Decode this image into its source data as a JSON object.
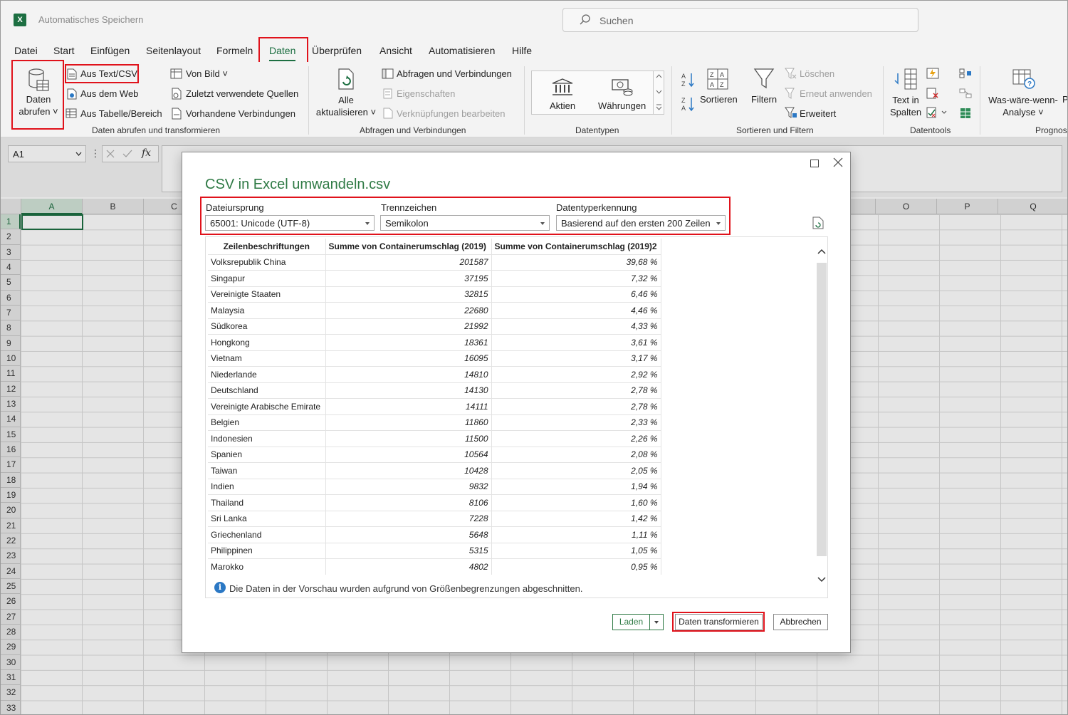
{
  "app": {
    "autosave_label": "Automatisches Speichern",
    "search_placeholder": "Suchen",
    "logo_letter": "X"
  },
  "menu_tabs": [
    "Datei",
    "Start",
    "Einfügen",
    "Seitenlayout",
    "Formeln",
    "Daten",
    "Überprüfen",
    "Ansicht",
    "Automatisieren",
    "Hilfe"
  ],
  "ribbon": {
    "get_data": {
      "label_line1": "Daten",
      "label_line2": "abrufen"
    },
    "from_text_csv": "Aus Text/CSV",
    "from_web": "Aus dem Web",
    "from_table": "Aus Tabelle/Bereich",
    "from_picture": "Von Bild",
    "recent_sources": "Zuletzt verwendete Quellen",
    "existing_connections": "Vorhandene Verbindungen",
    "group_get_transform": "Daten abrufen und transformieren",
    "refresh_all": {
      "label_line1": "Alle",
      "label_line2": "aktualisieren"
    },
    "queries_connections": "Abfragen und Verbindungen",
    "properties": "Eigenschaften",
    "edit_links": "Verknüpfungen bearbeiten",
    "group_queries": "Abfragen und Verbindungen",
    "stocks": "Aktien",
    "currencies": "Währungen",
    "group_datatypes": "Datentypen",
    "sort": "Sortieren",
    "filter": "Filtern",
    "clear": "Löschen",
    "reapply": "Erneut anwenden",
    "advanced": "Erweitert",
    "group_sort_filter": "Sortieren und Filtern",
    "text_to_columns": {
      "label_line1": "Text in",
      "label_line2": "Spalten"
    },
    "group_datatools": "Datentools",
    "whatif": {
      "label_line1": "Was-wäre-wenn-",
      "label_line2": "Analyse"
    },
    "forecast_trunc": "Prognos",
    "p_trunc": "P"
  },
  "formula_bar": {
    "name_box": "A1",
    "fx": "fx"
  },
  "grid": {
    "columns_left": [
      "A",
      "B",
      "C"
    ],
    "columns_right": [
      "O",
      "P",
      "Q"
    ],
    "rows": [
      "1",
      "2",
      "3",
      "4",
      "5",
      "6",
      "7",
      "8",
      "9",
      "10",
      "11",
      "12",
      "13",
      "14",
      "15",
      "16",
      "17",
      "18",
      "19",
      "20",
      "21",
      "22",
      "23",
      "24",
      "25",
      "26",
      "27",
      "28",
      "29",
      "30",
      "31",
      "32",
      "33"
    ]
  },
  "dialog": {
    "title": "CSV in Excel umwandeln.csv",
    "file_origin": {
      "label": "Dateiursprung",
      "value": "65001: Unicode (UTF-8)"
    },
    "delimiter": {
      "label": "Trennzeichen",
      "value": "Semikolon"
    },
    "datatype_detection": {
      "label": "Datentyperkennung",
      "value": "Basierend auf den ersten 200 Zeilen"
    },
    "table": {
      "headers": [
        "Zeilenbeschriftungen",
        "Summe von Containerumschlag (2019)",
        "Summe von Containerumschlag (2019)2"
      ],
      "rows": [
        [
          "Volksrepublik China",
          "201587",
          "39,68 %"
        ],
        [
          "Singapur",
          "37195",
          "7,32 %"
        ],
        [
          "Vereinigte Staaten",
          "32815",
          "6,46 %"
        ],
        [
          "Malaysia",
          "22680",
          "4,46 %"
        ],
        [
          "Südkorea",
          "21992",
          "4,33 %"
        ],
        [
          "Hongkong",
          "18361",
          "3,61 %"
        ],
        [
          "Vietnam",
          "16095",
          "3,17 %"
        ],
        [
          "Niederlande",
          "14810",
          "2,92 %"
        ],
        [
          "Deutschland",
          "14130",
          "2,78 %"
        ],
        [
          "Vereinigte Arabische Emirate",
          "14111",
          "2,78 %"
        ],
        [
          "Belgien",
          "11860",
          "2,33 %"
        ],
        [
          "Indonesien",
          "11500",
          "2,26 %"
        ],
        [
          "Spanien",
          "10564",
          "2,08 %"
        ],
        [
          "Taiwan",
          "10428",
          "2,05 %"
        ],
        [
          "Indien",
          "9832",
          "1,94 %"
        ],
        [
          "Thailand",
          "8106",
          "1,60 %"
        ],
        [
          "Sri Lanka",
          "7228",
          "1,42 %"
        ],
        [
          "Griechenland",
          "5648",
          "1,11 %"
        ],
        [
          "Philippinen",
          "5315",
          "1,05 %"
        ],
        [
          "Marokko",
          "4802",
          "0,95 %"
        ]
      ]
    },
    "info_message": "Die Daten in der Vorschau wurden aufgrund von Größenbegrenzungen abgeschnitten.",
    "buttons": {
      "load": "Laden",
      "transform": "Daten transformieren",
      "cancel": "Abbrechen"
    }
  },
  "colors": {
    "accent": "#1d6f42",
    "highlight": "#e0121b",
    "title": "#2f7a45"
  }
}
